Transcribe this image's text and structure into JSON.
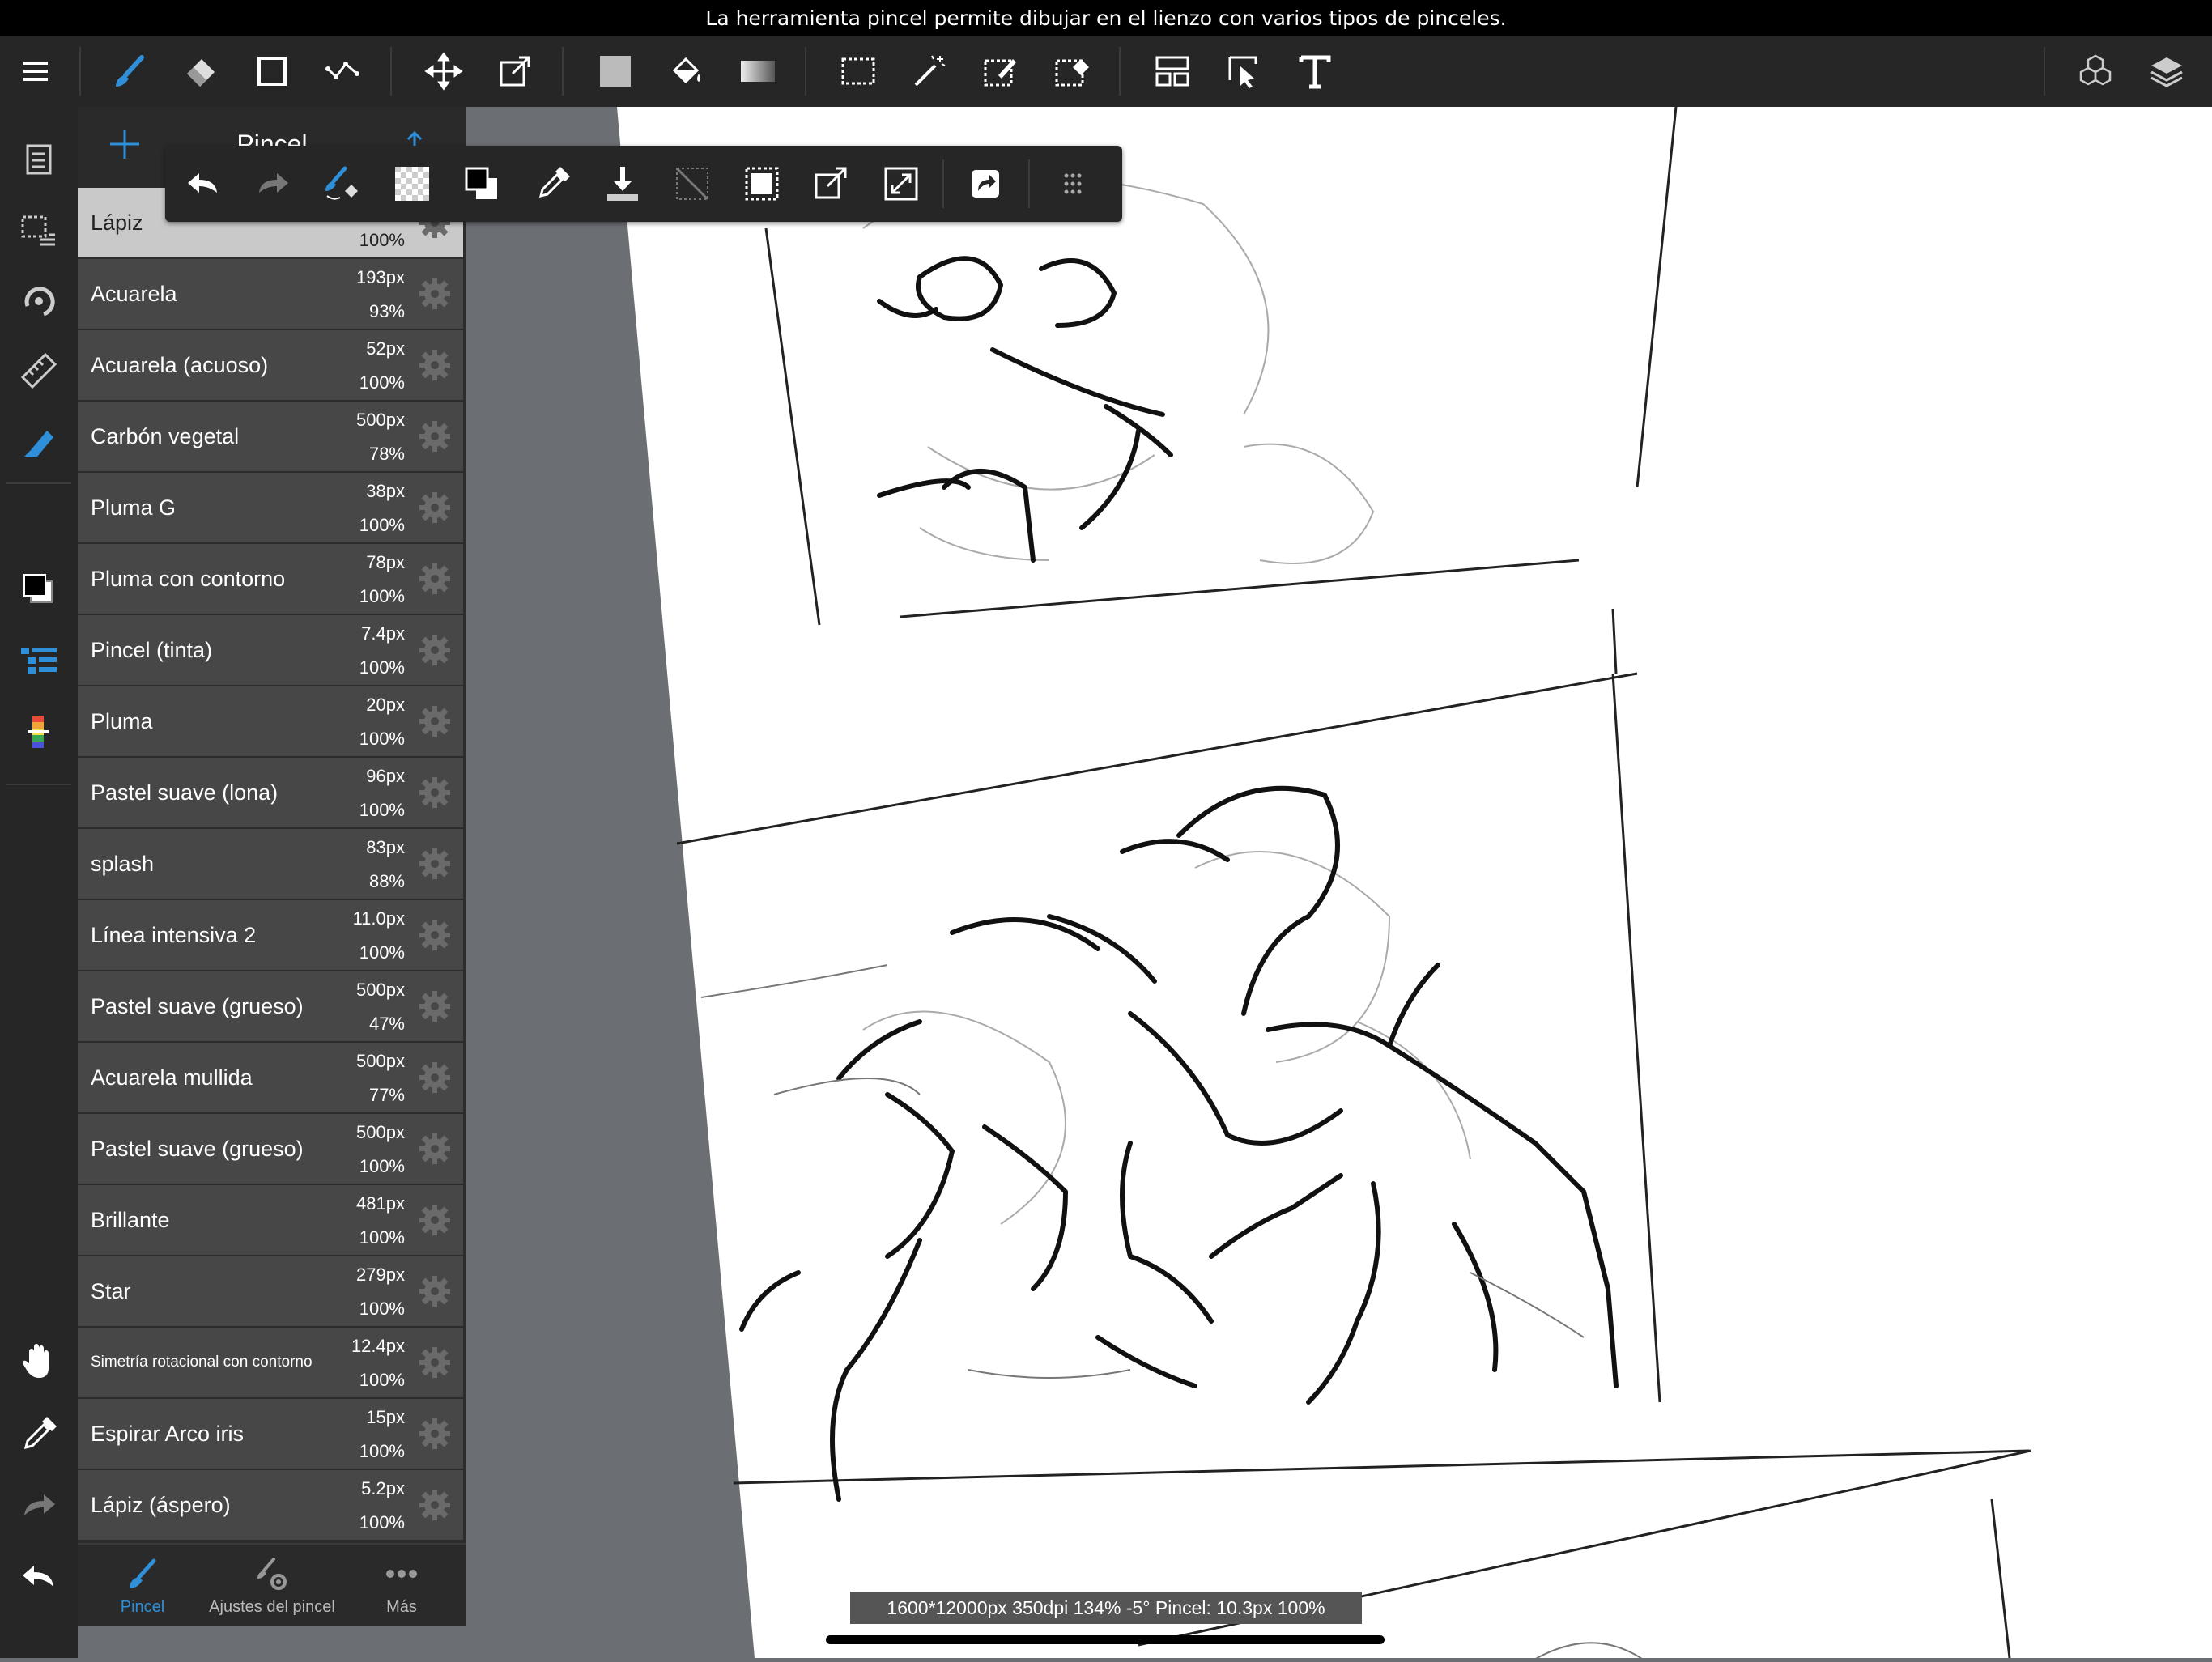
{
  "tooltip": {
    "text": "La herramienta pincel permite dibujar en el lienzo con varios tipos de pinceles."
  },
  "brush_panel": {
    "title": "Pincel",
    "brushes": [
      {
        "name": "Lápiz",
        "size": "",
        "opacity": "100%"
      },
      {
        "name": "Acuarela",
        "size": "193px",
        "opacity": "93%"
      },
      {
        "name": "Acuarela (acuoso)",
        "size": "52px",
        "opacity": "100%"
      },
      {
        "name": "Carbón vegetal",
        "size": "500px",
        "opacity": "78%"
      },
      {
        "name": "Pluma G",
        "size": "38px",
        "opacity": "100%"
      },
      {
        "name": "Pluma con contorno",
        "size": "78px",
        "opacity": "100%"
      },
      {
        "name": "Pincel (tinta)",
        "size": "7.4px",
        "opacity": "100%"
      },
      {
        "name": "Pluma",
        "size": "20px",
        "opacity": "100%"
      },
      {
        "name": "Pastel suave (lona)",
        "size": "96px",
        "opacity": "100%"
      },
      {
        "name": "splash",
        "size": "83px",
        "opacity": "88%"
      },
      {
        "name": "Línea intensiva 2",
        "size": "11.0px",
        "opacity": "100%"
      },
      {
        "name": "Pastel suave (grueso)",
        "size": "500px",
        "opacity": "47%"
      },
      {
        "name": "Acuarela mullida",
        "size": "500px",
        "opacity": "77%"
      },
      {
        "name": "Pastel suave (grueso)",
        "size": "500px",
        "opacity": "100%"
      },
      {
        "name": "Brillante",
        "size": "481px",
        "opacity": "100%"
      },
      {
        "name": "Star",
        "size": "279px",
        "opacity": "100%"
      },
      {
        "name": "Simetría rotacional con contorno",
        "size": "12.4px",
        "opacity": "100%"
      },
      {
        "name": "Espirar Arco iris",
        "size": "15px",
        "opacity": "100%"
      },
      {
        "name": "Lápiz (áspero)",
        "size": "5.2px",
        "opacity": "100%"
      }
    ],
    "tabs": [
      {
        "label": "Pincel"
      },
      {
        "label": "Ajustes del pincel"
      },
      {
        "label": "Más"
      }
    ]
  },
  "status": {
    "text": "1600*12000px 350dpi 134% -5° Pincel: 10.3px 100%"
  },
  "colors": {
    "accent": "#2f8fd8",
    "toolbar": "#262626",
    "row": "#474747",
    "row_selected": "#c9c9c9"
  }
}
